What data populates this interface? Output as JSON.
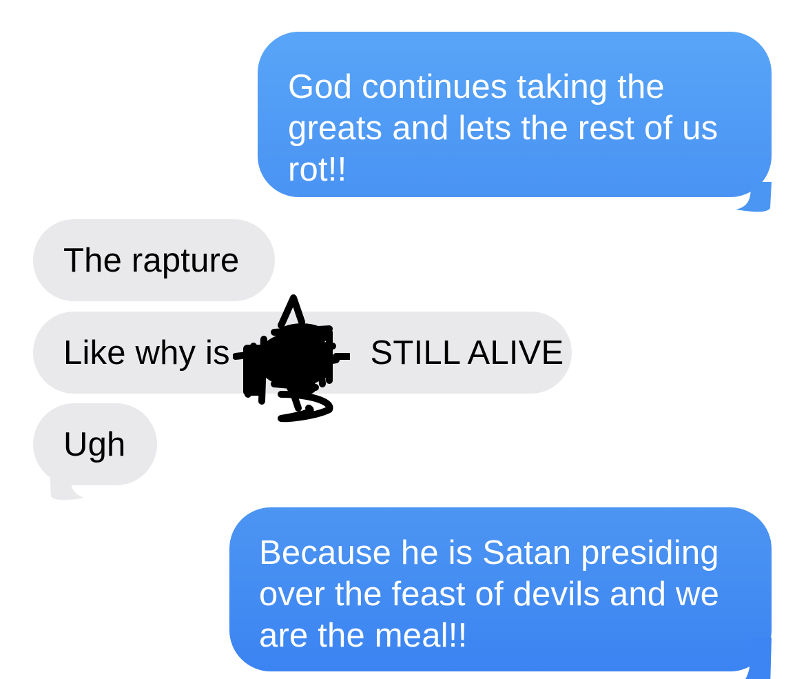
{
  "conversation": {
    "colors": {
      "sent_bubble": "#4a93f3",
      "received_bubble": "#e9e9eb",
      "sent_text": "#ffffff",
      "received_text": "#000000",
      "redaction": "#000000"
    },
    "messages": [
      {
        "direction": "sent",
        "lines": [
          "God continues taking the",
          "greats and lets the rest of us",
          "rot!!"
        ]
      },
      {
        "direction": "received",
        "lines": [
          "The rapture"
        ]
      },
      {
        "direction": "received",
        "before_redaction": "Like why is",
        "after_redaction": "STILL ALIVE"
      },
      {
        "direction": "received",
        "lines": [
          "Ugh"
        ]
      },
      {
        "direction": "sent",
        "lines": [
          "Because he is Satan presiding",
          "over the feast of devils and we",
          "are the meal!!"
        ]
      }
    ]
  }
}
